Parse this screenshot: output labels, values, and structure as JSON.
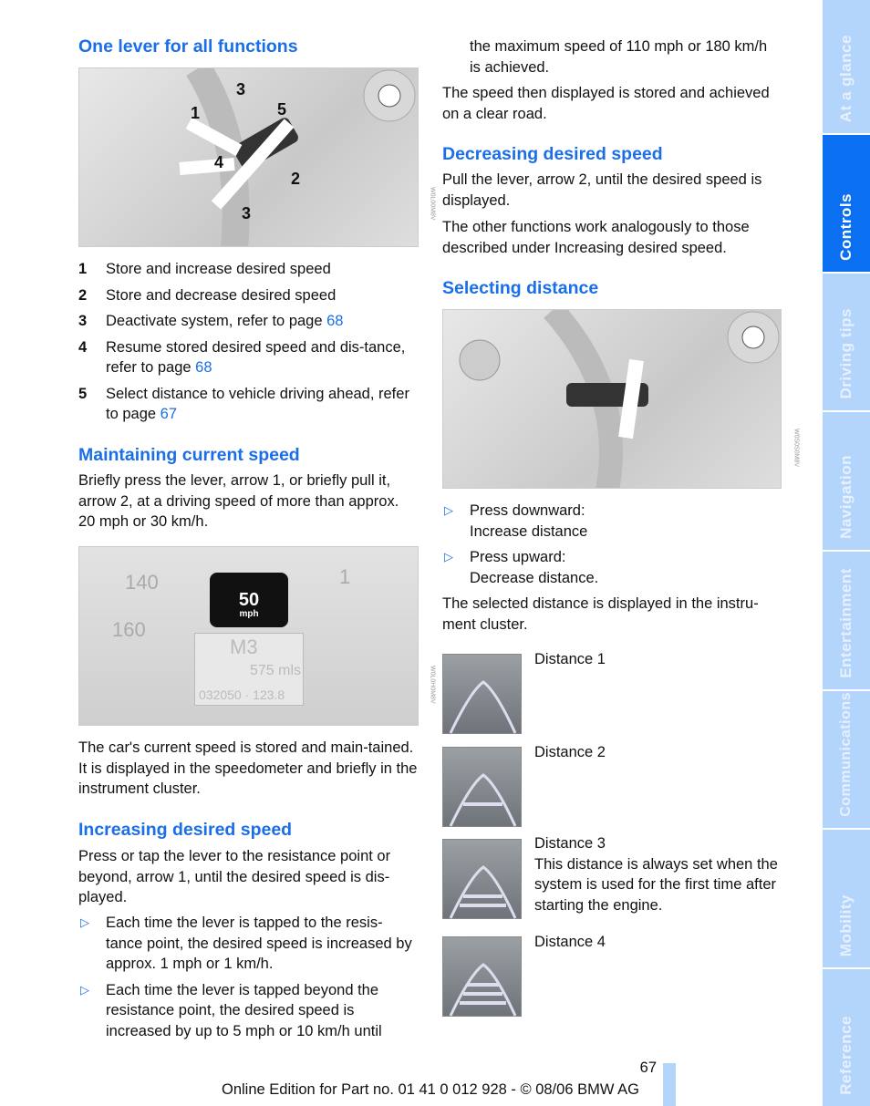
{
  "left": {
    "h_one_lever": "One lever for all functions",
    "fig1_numbers": [
      "1",
      "2",
      "3",
      "4",
      "5",
      "3"
    ],
    "fig1_code": "W0L00M8V",
    "items": [
      {
        "n": "1",
        "text": "Store and increase desired speed",
        "link": ""
      },
      {
        "n": "2",
        "text": "Store and decrease desired speed",
        "link": ""
      },
      {
        "n": "3",
        "text": "Deactivate system, refer to page ",
        "link": "68"
      },
      {
        "n": "4",
        "text": "Resume stored desired speed and dis-tance, refer to page ",
        "link": "68"
      },
      {
        "n": "5",
        "text": "Select distance to vehicle driving ahead, refer to page ",
        "link": "67"
      }
    ],
    "h_maintaining": "Maintaining current speed",
    "p_maintaining": "Briefly press the lever, arrow 1, or briefly pull it, arrow 2, at a driving speed of more than approx. 20 mph or 30 km/h.",
    "fig2": {
      "speed": "50",
      "unit": "mph",
      "gear": "M3",
      "range": "575 mls",
      "odo": "032050 · 123.8",
      "ticks": [
        "140",
        "160",
        "1"
      ],
      "code": "W0L0H0M8V"
    },
    "p_stored": "The car's current speed is stored and main-tained. It is displayed in the speedometer and briefly in the instrument cluster.",
    "h_increasing": "Increasing desired speed",
    "p_increasing": "Press or tap the lever to the resistance point or beyond, arrow 1, until the desired speed is dis-played.",
    "bullets": [
      "Each time the lever is tapped to the resis-tance point, the desired speed is increased by approx. 1 mph or 1 km/h.",
      "Each time the lever is tapped beyond the resistance point, the desired speed is increased by up to 5 mph or 10 km/h until"
    ]
  },
  "right": {
    "p_cont": "the maximum speed of 110 mph or 180 km/h is achieved.",
    "p_stored": "The speed then displayed is stored and achieved on a clear road.",
    "h_decreasing": "Decreasing desired speed",
    "p_decreasing": "Pull the lever, arrow 2, until the desired speed is displayed.",
    "p_other": "The other functions work analogously to those described under Increasing desired speed.",
    "h_selecting": "Selecting distance",
    "fig3_code": "W0S0S0M8V",
    "bullets": [
      {
        "a": "Press downward:",
        "b": "Increase distance"
      },
      {
        "a": "Press upward:",
        "b": "Decrease distance."
      }
    ],
    "p_displayed": "The selected distance is displayed in the instru-ment cluster.",
    "distances": [
      {
        "label": "Distance 1",
        "desc": ""
      },
      {
        "label": "Distance 2",
        "desc": ""
      },
      {
        "label": "Distance 3",
        "desc": "This distance is always set when the system is used for the first time after starting the engine."
      },
      {
        "label": "Distance 4",
        "desc": ""
      }
    ]
  },
  "sidebar": {
    "tabs": [
      "At a glance",
      "Controls",
      "Driving tips",
      "Navigation",
      "Entertainment",
      "Communications",
      "Mobility",
      "Reference"
    ],
    "active": "Controls"
  },
  "footer": {
    "page": "67",
    "text": "Online Edition for Part no. 01 41 0 012 928 - © 08/06 BMW AG"
  },
  "colors": {
    "heading": "#1a6fe8",
    "tab": "#b3d4fb",
    "tab_active": "#0a6ff0"
  }
}
